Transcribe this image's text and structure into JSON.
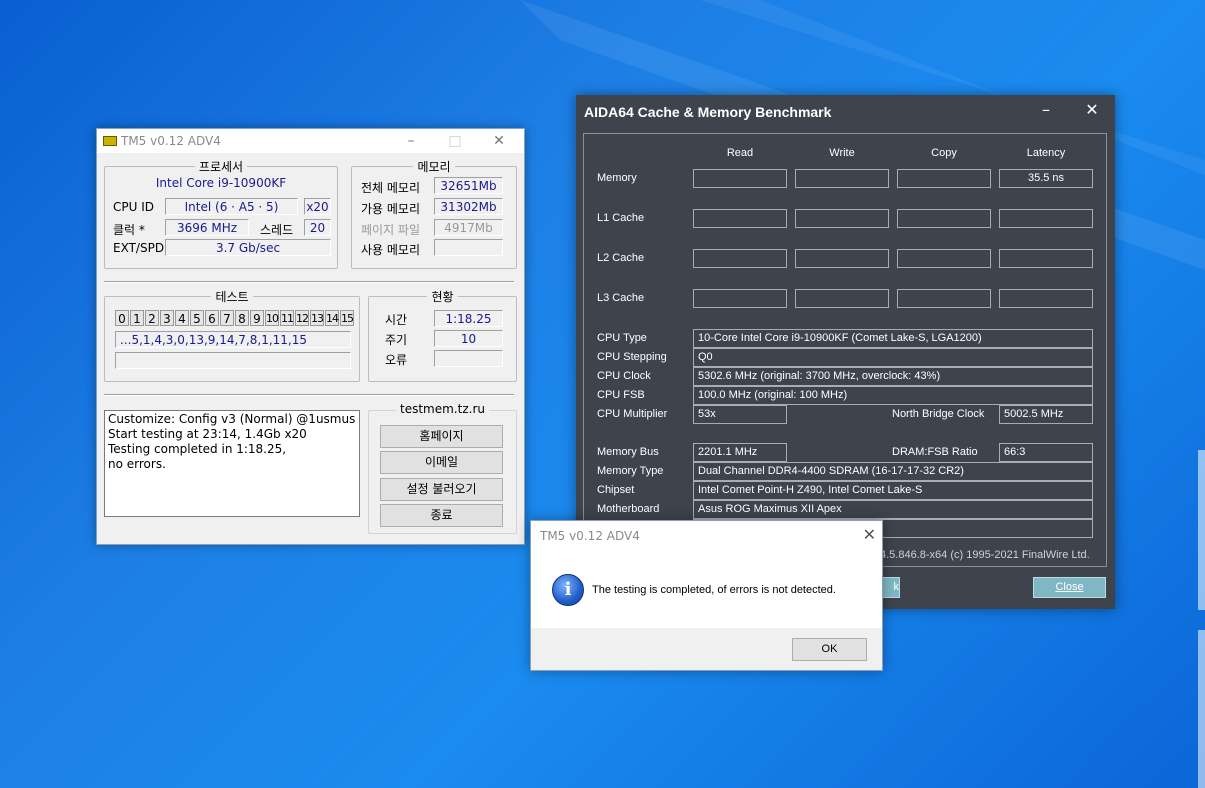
{
  "tm5": {
    "title": "TM5 v0.12 ADV4",
    "processor": {
      "group_title": "프로세서",
      "cpu_name": "Intel Core i9-10900KF",
      "cpu_id_label": "CPU ID",
      "cpu_id_value": "Intel  (6 · A5 · 5)",
      "cpu_id_mult": "x20",
      "clock_label": "클럭 *",
      "clock_value": "3696 MHz",
      "thread_label": "스레드",
      "thread_value": "20",
      "ext_label": "EXT/SPD",
      "ext_value": "3.7 Gb/sec"
    },
    "memory": {
      "group_title": "메모리",
      "total_label": "전체 메모리",
      "total_value": "32651Mb",
      "avail_label": "가용 메모리",
      "avail_value": "31302Mb",
      "page_label": "페이지 파일",
      "page_value": "4917Mb",
      "used_label": "사용 메모리",
      "used_value": ""
    },
    "tests": {
      "group_title": "테스트",
      "cells": [
        "0",
        "1",
        "2",
        "3",
        "4",
        "5",
        "6",
        "7",
        "8",
        "9",
        "10",
        "11",
        "12",
        "13",
        "14",
        "15"
      ],
      "sequence": "...5,1,4,3,0,13,9,14,7,8,1,11,15",
      "progress": ""
    },
    "status": {
      "group_title": "현황",
      "time_label": "시간",
      "time_value": "1:18.25",
      "cycle_label": "주기",
      "cycle_value": "10",
      "error_label": "오류",
      "error_value": ""
    },
    "log": [
      "Customize: Config v3 (Normal) @1usmus",
      "Start testing at 23:14, 1.4Gb x20",
      "Testing completed in 1:18.25,",
      "no errors."
    ],
    "site": "testmem.tz.ru",
    "buttons": {
      "home": "홈페이지",
      "email": "이메일",
      "load": "설정 불러오기",
      "exit": "종료"
    }
  },
  "aida": {
    "title": "AIDA64 Cache & Memory Benchmark",
    "columns": [
      "Read",
      "Write",
      "Copy",
      "Latency"
    ],
    "rows": [
      {
        "label": "Memory",
        "values": [
          "",
          "",
          "",
          "35.5 ns"
        ]
      },
      {
        "label": "L1 Cache",
        "values": [
          "",
          "",
          "",
          ""
        ]
      },
      {
        "label": "L2 Cache",
        "values": [
          "",
          "",
          "",
          ""
        ]
      },
      {
        "label": "L3 Cache",
        "values": [
          "",
          "",
          "",
          ""
        ]
      }
    ],
    "info": {
      "cpu_type_label": "CPU Type",
      "cpu_type": "10-Core Intel Core i9-10900KF  (Comet Lake-S, LGA1200)",
      "cpu_stepping_label": "CPU Stepping",
      "cpu_stepping": "Q0",
      "cpu_clock_label": "CPU Clock",
      "cpu_clock": "5302.6 MHz  (original: 3700 MHz, overclock: 43%)",
      "cpu_fsb_label": "CPU FSB",
      "cpu_fsb": "100.0 MHz  (original: 100 MHz)",
      "cpu_mult_label": "CPU Multiplier",
      "cpu_mult": "53x",
      "nb_clock_label": "North Bridge Clock",
      "nb_clock": "5002.5 MHz",
      "mem_bus_label": "Memory Bus",
      "mem_bus": "2201.1 MHz",
      "dram_ratio_label": "DRAM:FSB Ratio",
      "dram_ratio": "66:3",
      "mem_type_label": "Memory Type",
      "mem_type": "Dual Channel DDR4-4400 SDRAM  (16-17-17-32 CR2)",
      "chipset_label": "Chipset",
      "chipset": "Intel Comet Point-H Z490, Intel Comet Lake-S",
      "mobo_label": "Motherboard",
      "mobo": "Asus ROG Maximus XII Apex"
    },
    "footer_version": "4.5.846.8-x64  (c) 1995-2021 FinalWire Ltd.",
    "partial_button": "k",
    "close_button": "Close"
  },
  "dialog": {
    "title": "TM5 v0.12 ADV4",
    "message": "The testing is completed, of errors is not detected.",
    "icon_glyph": "i",
    "ok": "OK"
  }
}
